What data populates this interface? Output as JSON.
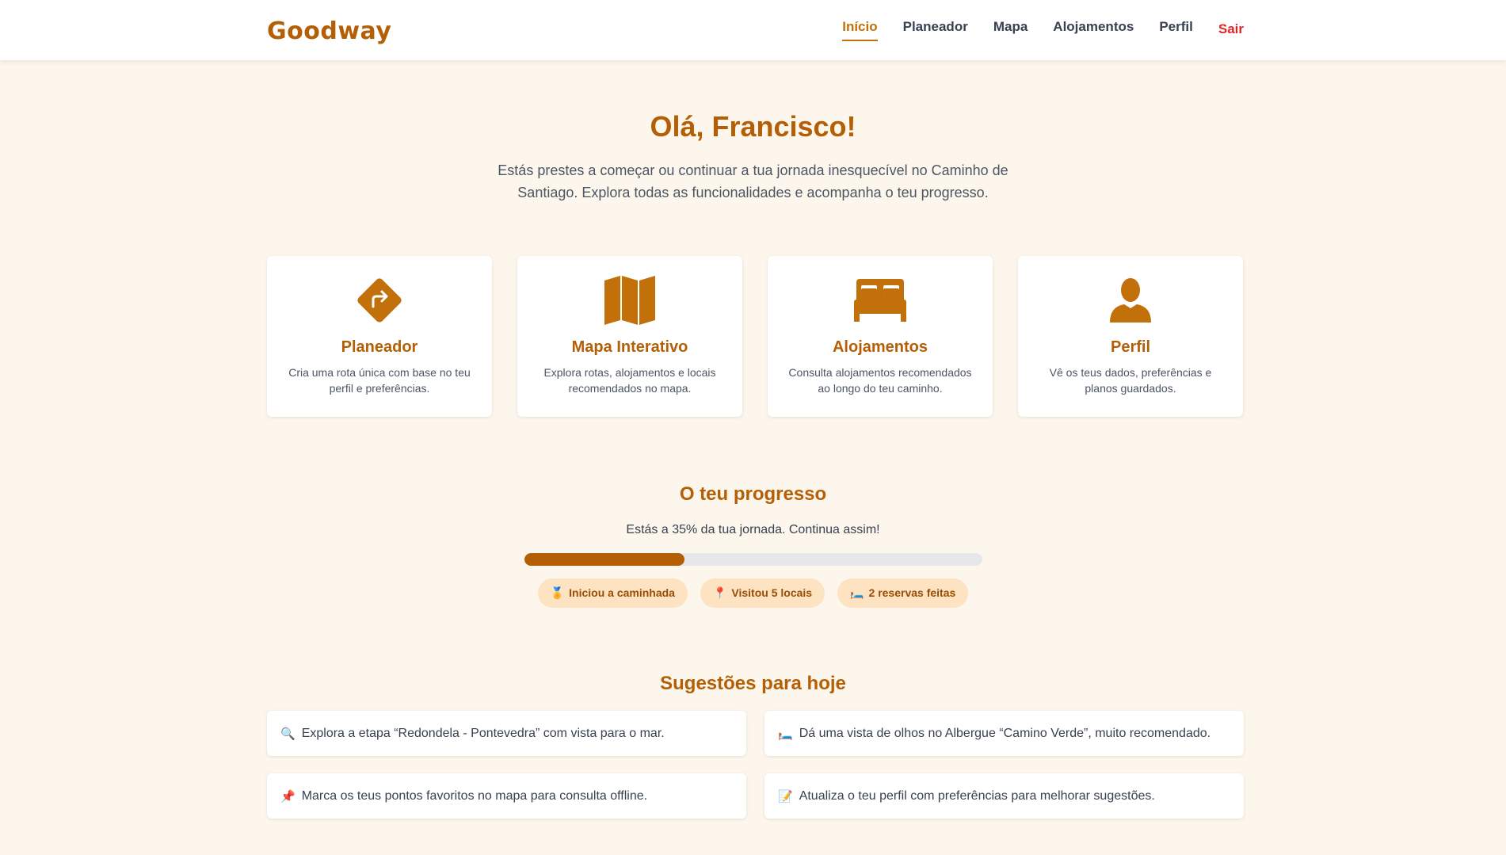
{
  "app": {
    "brand": "Goodway"
  },
  "nav": {
    "items": [
      {
        "label": "Início",
        "active": true
      },
      {
        "label": "Planeador",
        "active": false
      },
      {
        "label": "Mapa",
        "active": false
      },
      {
        "label": "Alojamentos",
        "active": false
      },
      {
        "label": "Perfil",
        "active": false
      }
    ],
    "logout": "Sair"
  },
  "hero": {
    "title": "Olá, Francisco!",
    "subtitle": "Estás prestes a começar ou continuar a tua jornada inesquecível no Caminho de Santiago. Explora todas as funcionalidades e acompanha o teu progresso."
  },
  "cards": [
    {
      "icon": "directions-icon",
      "title": "Planeador",
      "desc": "Cria uma rota única com base no teu perfil e preferências."
    },
    {
      "icon": "map-icon",
      "title": "Mapa Interativo",
      "desc": "Explora rotas, alojamentos e locais recomendados no mapa."
    },
    {
      "icon": "bed-icon",
      "title": "Alojamentos",
      "desc": "Consulta alojamentos recomendados ao longo do teu caminho."
    },
    {
      "icon": "user-icon",
      "title": "Perfil",
      "desc": "Vê os teus dados, preferências e planos guardados."
    }
  ],
  "progress": {
    "title": "O teu progresso",
    "text": "Estás a 35% da tua jornada. Continua assim!",
    "percent": 35,
    "badges": [
      {
        "emoji": "🏅",
        "label": "Iniciou a caminhada"
      },
      {
        "emoji": "📍",
        "label": "Visitou 5 locais"
      },
      {
        "emoji": "🛏️",
        "label": "2 reservas feitas"
      }
    ]
  },
  "suggestions": {
    "title": "Sugestões para hoje",
    "items": [
      {
        "emoji": "🔍",
        "text": "Explora a etapa “Redondela - Pontevedra” com vista para o mar."
      },
      {
        "emoji": "🛏️",
        "text": "Dá uma vista de olhos no Albergue “Camino Verde”, muito recomendado."
      },
      {
        "emoji": "📌",
        "text": "Marca os teus pontos favoritos no mapa para consulta offline."
      },
      {
        "emoji": "📝",
        "text": "Atualiza o teu perfil com preferências para melhorar sugestões."
      }
    ]
  },
  "colors": {
    "accent": "#b45f06",
    "background": "#fdf6ec",
    "badge_bg": "#fde3c2",
    "logout": "#dc2626"
  }
}
